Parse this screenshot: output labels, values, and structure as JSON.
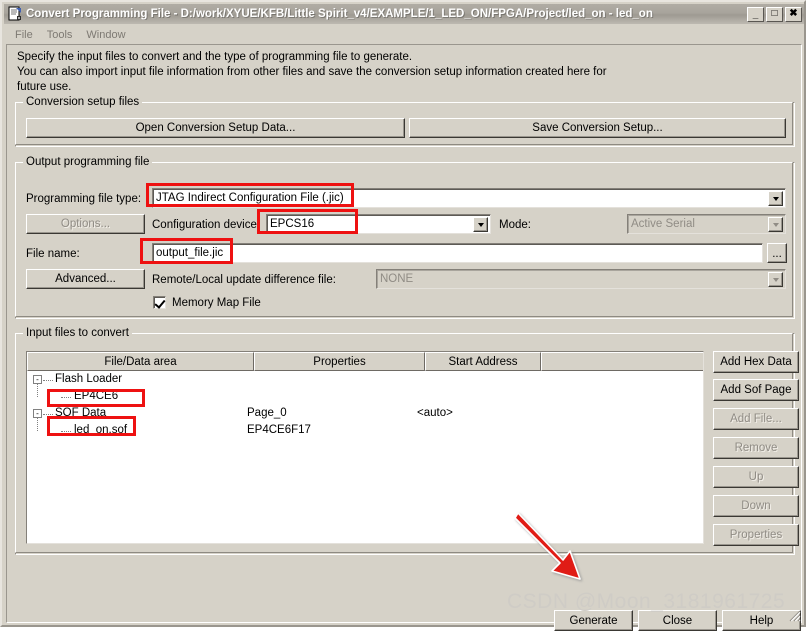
{
  "window": {
    "title": "Convert Programming File - D:/work/XYUE/KFB/Little Spirit_v4/EXAMPLE/1_LED_ON/FPGA/Project/led_on - led_on",
    "minimize_label": "_",
    "maximize_label": "❐",
    "close_label": "✕",
    "app_icon": "document-convert-icon"
  },
  "menubar": {
    "items": [
      {
        "label": "File"
      },
      {
        "label": "Tools"
      },
      {
        "label": "Window"
      }
    ]
  },
  "description": {
    "line1": "Specify the input files to convert and the type of programming file to generate.",
    "line2": "You can also import input file information from other files and save the conversion setup information created here for",
    "line3": "future use."
  },
  "conversion_setup": {
    "group_title": "Conversion setup files",
    "open_button": "Open Conversion Setup Data...",
    "save_button": "Save Conversion Setup..."
  },
  "output_programming_file": {
    "group_title": "Output programming file",
    "programming_file_type_label": "Programming file type:",
    "programming_file_type_value": "JTAG Indirect Configuration File (.jic)",
    "options_button": "Options...",
    "configuration_device_label": "Configuration device:",
    "configuration_device_value": "EPCS16",
    "mode_label": "Mode:",
    "mode_value": "Active Serial",
    "file_name_label": "File name:",
    "file_name_value": "output_file.jic",
    "browse_button": "...",
    "advanced_button": "Advanced...",
    "remote_local_label": "Remote/Local update difference file:",
    "remote_local_value": "NONE",
    "memory_map_label": "Memory Map File",
    "memory_map_checked": true
  },
  "input_files": {
    "group_title": "Input files to convert",
    "columns": [
      {
        "label": "File/Data area"
      },
      {
        "label": "Properties"
      },
      {
        "label": "Start Address"
      },
      {
        "label": ""
      }
    ],
    "rows": [
      {
        "name": "Flash Loader",
        "properties": "",
        "start_address": "",
        "level": 0,
        "expander": "-"
      },
      {
        "name": "EP4CE6",
        "properties": "",
        "start_address": "",
        "level": 1,
        "expander": ""
      },
      {
        "name": "SOF Data",
        "properties": "Page_0",
        "start_address": "<auto>",
        "level": 0,
        "expander": "-"
      },
      {
        "name": "led_on.sof",
        "properties": "EP4CE6F17",
        "start_address": "",
        "level": 1,
        "expander": ""
      }
    ],
    "side_buttons": [
      {
        "label": "Add Hex Data",
        "enabled": true
      },
      {
        "label": "Add Sof Page",
        "enabled": true
      },
      {
        "label": "Add File...",
        "enabled": false
      },
      {
        "label": "Remove",
        "enabled": false
      },
      {
        "label": "Up",
        "enabled": false
      },
      {
        "label": "Down",
        "enabled": false
      },
      {
        "label": "Properties",
        "enabled": false
      }
    ]
  },
  "footer": {
    "generate_button": "Generate",
    "close_button": "Close",
    "help_button": "Help"
  },
  "annotations": {
    "highlight_color": "#ee1111",
    "arrow_color": "#e01b15",
    "watermark": "CSDN @Moon_3181961725"
  }
}
